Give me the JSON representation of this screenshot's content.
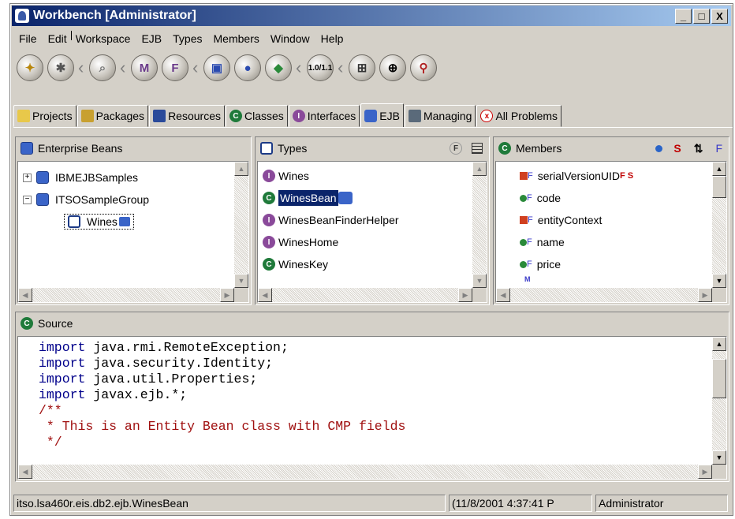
{
  "window": {
    "title": "Workbench [Administrator]",
    "caption": {
      "minimize": "_",
      "maximize": "□",
      "close": "X"
    }
  },
  "menu": [
    "File",
    "Edit",
    "Workspace",
    "EJB",
    "Types",
    "Members",
    "Window",
    "Help"
  ],
  "toolbar": {
    "buttons": [
      {
        "icon": "run-icon"
      },
      {
        "icon": "debug-icon"
      },
      {
        "icon": "search-flashlight-icon"
      },
      {
        "icon": "method-icon"
      },
      {
        "icon": "field-icon"
      },
      {
        "icon": "new-bean-icon"
      },
      {
        "icon": "new-ejb-group-icon"
      },
      {
        "icon": "generate-icon"
      },
      {
        "icon": "version-icon",
        "label": "1.0/1.1"
      },
      {
        "icon": "export-icon"
      },
      {
        "icon": "web-icon"
      },
      {
        "icon": "team-icon"
      }
    ]
  },
  "tabs": [
    {
      "label": "Projects",
      "icon": "folder-icon"
    },
    {
      "label": "Packages",
      "icon": "packages-icon"
    },
    {
      "label": "Resources",
      "icon": "resources-icon"
    },
    {
      "label": "Classes",
      "icon": "class-icon"
    },
    {
      "label": "Interfaces",
      "icon": "interface-icon"
    },
    {
      "label": "EJB",
      "icon": "ejb-icon",
      "active": true
    },
    {
      "label": "Managing",
      "icon": "managing-icon"
    },
    {
      "label": "All Problems",
      "icon": "problems-icon"
    }
  ],
  "enterprise_beans": {
    "title": "Enterprise Beans",
    "items": [
      {
        "label": "IBMEJBSamples",
        "expander": "+"
      },
      {
        "label": "ITSOSampleGroup",
        "expander": "−"
      },
      {
        "label": "Wines",
        "selected": true
      }
    ]
  },
  "types": {
    "title": "Types",
    "items": [
      {
        "label": "Wines",
        "kind": "interface"
      },
      {
        "label": "WinesBean",
        "kind": "class",
        "selected": true
      },
      {
        "label": "WinesBeanFinderHelper",
        "kind": "interface"
      },
      {
        "label": "WinesHome",
        "kind": "interface"
      },
      {
        "label": "WinesKey",
        "kind": "class"
      }
    ]
  },
  "members": {
    "title": "Members",
    "toolbar": {
      "static": "S",
      "final": "F"
    },
    "items": [
      {
        "label": "serialVersionUID",
        "flags": "F S",
        "kind": "private"
      },
      {
        "label": "code",
        "flags": "",
        "kind": "public"
      },
      {
        "label": "entityContext",
        "flags": "",
        "kind": "private"
      },
      {
        "label": "name",
        "flags": "",
        "kind": "public"
      },
      {
        "label": "price",
        "flags": "",
        "kind": "public"
      }
    ],
    "superscript": "F",
    "method_marker": "M"
  },
  "source": {
    "title": "Source",
    "lines": [
      {
        "kw": "import",
        "rest": " java.rmi.RemoteException;"
      },
      {
        "kw": "import",
        "rest": " java.security.Identity;"
      },
      {
        "kw": "import",
        "rest": " java.util.Properties;"
      },
      {
        "kw": "import",
        "rest": " javax.ejb.*;"
      }
    ],
    "comment_lines": [
      "/**",
      " * This is an Entity Bean class with CMP fields",
      " */"
    ]
  },
  "status": {
    "path": "itso.lsa460r.eis.db2.ejb.WinesBean",
    "timestamp": "(11/8/2001 4:37:41 P",
    "user": "Administrator"
  },
  "colors": {
    "selection": "#0a246a",
    "class_icon": "#1f7a3a",
    "interface_icon": "#8a4a9a",
    "flag": "#c00000"
  }
}
